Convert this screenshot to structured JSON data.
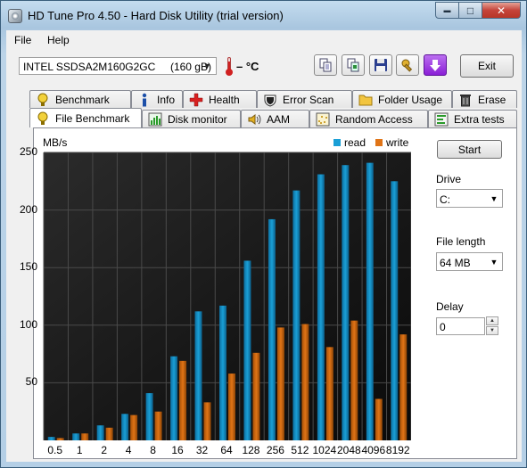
{
  "window": {
    "title": "HD Tune Pro 4.50 - Hard Disk Utility (trial version)",
    "min_label": "▬",
    "max_label": "□",
    "close_label": "✕"
  },
  "menu": {
    "file": "File",
    "help": "Help"
  },
  "toolbar": {
    "drive": "INTEL SSDSA2M160G2GC     (160 gB)",
    "temperature": "– °C",
    "exit_label": "Exit"
  },
  "tabs_row1": [
    {
      "label": "Benchmark",
      "icon": "benchmark-icon"
    },
    {
      "label": "Info",
      "icon": "info-icon"
    },
    {
      "label": "Health",
      "icon": "health-icon"
    },
    {
      "label": "Error Scan",
      "icon": "error-scan-icon"
    },
    {
      "label": "Folder Usage",
      "icon": "folder-icon"
    },
    {
      "label": "Erase",
      "icon": "trash-icon"
    }
  ],
  "tabs_row2": [
    {
      "label": "File Benchmark",
      "icon": "file-benchmark-icon",
      "active": true
    },
    {
      "label": "Disk monitor",
      "icon": "disk-monitor-icon"
    },
    {
      "label": "AAM",
      "icon": "speaker-icon"
    },
    {
      "label": "Random Access",
      "icon": "random-access-icon"
    },
    {
      "label": "Extra tests",
      "icon": "extra-tests-icon"
    }
  ],
  "side": {
    "start_label": "Start",
    "drive_label": "Drive",
    "drive_value": "C:",
    "file_length_label": "File length",
    "file_length_value": "64 MB",
    "delay_label": "Delay",
    "delay_value": "0"
  },
  "colors": {
    "read": "#1a9fd6",
    "write": "#e07416",
    "chart_bg": "#0f0f0f"
  },
  "chart_data": {
    "type": "bar",
    "ylabel": "MB/s",
    "ylim": [
      0,
      250
    ],
    "yticks": [
      50,
      100,
      150,
      200,
      250
    ],
    "categories": [
      "0.5",
      "1",
      "2",
      "4",
      "8",
      "16",
      "32",
      "64",
      "128",
      "256",
      "512",
      "1024",
      "2048",
      "4096",
      "8192"
    ],
    "series": [
      {
        "name": "read",
        "values": [
          3,
          6,
          13,
          23,
          41,
          73,
          112,
          117,
          156,
          192,
          217,
          231,
          239,
          241,
          225
        ]
      },
      {
        "name": "write",
        "values": [
          2,
          6,
          11,
          22,
          25,
          69,
          33,
          58,
          76,
          98,
          101,
          81,
          104,
          36,
          92
        ]
      }
    ],
    "grid": true,
    "legend": "top-right"
  }
}
